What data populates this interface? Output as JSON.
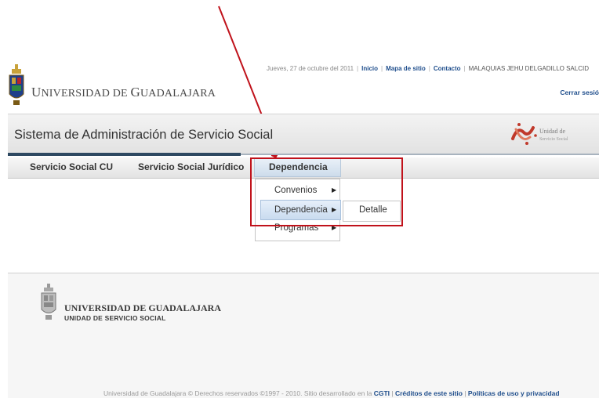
{
  "header": {
    "date": "Jueves, 27 de octubre del 2011",
    "links": [
      "Inicio",
      "Mapa de sitio",
      "Contacto"
    ],
    "user": "MALAQUIAS JEHU DELGADILLO SALCID",
    "logout": "Cerrar sesió",
    "university_initial": "U",
    "university_rest_a": "NIVERSIDAD DE ",
    "university_initial_b": "G",
    "university_rest_b": "UADALAJARA"
  },
  "banner": {
    "title": "Sistema de Administración de Servicio Social",
    "logo_line1": "Unidad de",
    "logo_line2": "Servicio Social"
  },
  "nav": {
    "items": [
      "Servicio Social CU",
      "Servicio Social Jurídico",
      "Dependencia"
    ]
  },
  "dropdown": {
    "items": [
      "Convenios",
      "Dependencia",
      "Programas"
    ],
    "submenu_item": "Detalle"
  },
  "footer": {
    "university": "UNIVERSIDAD DE GUADALAJARA",
    "unit": "UNIDAD DE SERVICIO SOCIAL",
    "copyright": "Universidad de Guadalajara © Derechos reservados ©1997 - 2010. Sitio desarrollado en la",
    "cgti": "CGTI",
    "credits": "Créditos de este sitio",
    "policies": "Políticas de uso y privacidad"
  },
  "colors": {
    "annotation": "#c0121b",
    "link": "#1f4e8c",
    "banner_bar": "#2d4861"
  }
}
